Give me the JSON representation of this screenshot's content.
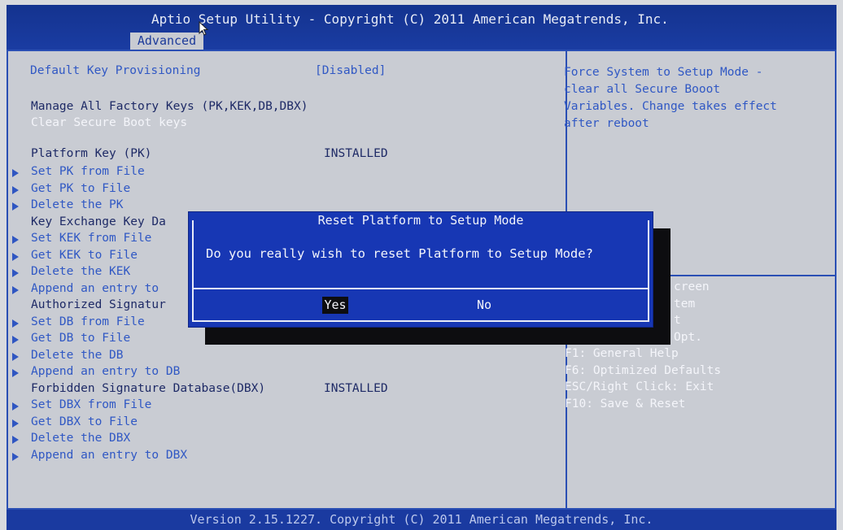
{
  "header": {
    "title": "Aptio Setup Utility - Copyright (C) 2011 American Megatrends, Inc.",
    "tab": "Advanced"
  },
  "settings": {
    "default_key_provisioning": {
      "label": "Default Key Provisioning",
      "value": "[Disabled]"
    },
    "manage_keys_label": "Manage All Factory Keys (PK,KEK,DB,DBX)",
    "clear_keys": "Clear Secure Boot keys",
    "pk": {
      "label": "Platform Key (PK)",
      "status": "INSTALLED"
    },
    "pk_items": [
      "Set PK from File",
      "Get PK to File",
      "Delete the PK"
    ],
    "kek_label": "Key Exchange Key Da",
    "kek_items": [
      "Set KEK from File",
      "Get KEK to File",
      "Delete the KEK",
      "Append an entry to"
    ],
    "db_label": "Authorized Signatur",
    "db_items": [
      "Set DB from File",
      "Get DB to File",
      "Delete the DB",
      "Append an entry to DB"
    ],
    "dbx": {
      "label": "Forbidden Signature Database(DBX)",
      "status": "INSTALLED"
    },
    "dbx_items": [
      "Set DBX from File",
      "Get DBX to File",
      "Delete the DBX",
      "Append an entry to DBX"
    ]
  },
  "help": {
    "lines": [
      "Force System to Setup Mode -",
      "clear all Secure Booot",
      "Variables. Change takes effect",
      "after reboot"
    ],
    "keys": [
      "creen",
      "tem",
      "t",
      "Opt.",
      "F1: General Help",
      "F6: Optimized Defaults",
      "ESC/Right Click: Exit",
      "F10: Save & Reset"
    ]
  },
  "dialog": {
    "title": "Reset Platform to Setup Mode",
    "message": "Do you really wish to reset Platform to Setup Mode?",
    "yes": "Yes",
    "no": "No"
  },
  "footer": {
    "text": "Version 2.15.1227. Copyright (C) 2011 American Megatrends, Inc."
  },
  "colors": {
    "bar_blue": "#1a3aa0",
    "panel_gray": "#c9ccd3",
    "dialog_blue": "#1737b4",
    "link_blue": "#3058c4"
  }
}
